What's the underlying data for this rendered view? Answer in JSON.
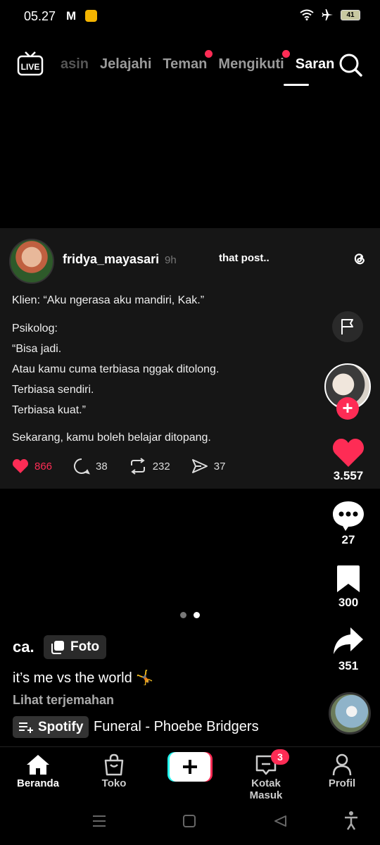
{
  "status_bar": {
    "time": "05.27",
    "mail_letter": "M",
    "battery": "41"
  },
  "top_nav": {
    "live_label": "LIVE",
    "tabs": [
      {
        "label": "asin"
      },
      {
        "label": "Jelajahi"
      },
      {
        "label": "Teman"
      },
      {
        "label": "Mengikuti"
      },
      {
        "label": "Saran"
      }
    ]
  },
  "post": {
    "username": "fridya_mayasari",
    "time": "9h",
    "overlay_text": "that post..",
    "lines": [
      "Klien: “Aku ngerasa aku mandiri, Kak.”",
      "Psikolog:",
      "“Bisa jadi.",
      "Atau kamu cuma terbiasa nggak ditolong.",
      "Terbiasa sendiri.",
      "Terbiasa kuat.”",
      "Sekarang, kamu boleh belajar ditopang."
    ],
    "stats": {
      "likes": "866",
      "replies": "38",
      "reposts": "232",
      "shares": "37"
    }
  },
  "rail": {
    "likes": "3.557",
    "comments": "27",
    "saves": "300",
    "shares": "351"
  },
  "caption": {
    "username": "ca.",
    "badge": "Foto",
    "text": "it’s me vs the world 🤸",
    "translate": "Lihat terjemahan",
    "music_source": "Spotify",
    "song": "Funeral - Phoebe Bridgers"
  },
  "bottom_nav": {
    "home": "Beranda",
    "shop": "Toko",
    "inbox": "Kotak Masuk",
    "inbox_badge": "3",
    "profile": "Profil"
  },
  "colors": {
    "accent": "#fe2c55",
    "background": "#000000",
    "card": "#161616"
  }
}
